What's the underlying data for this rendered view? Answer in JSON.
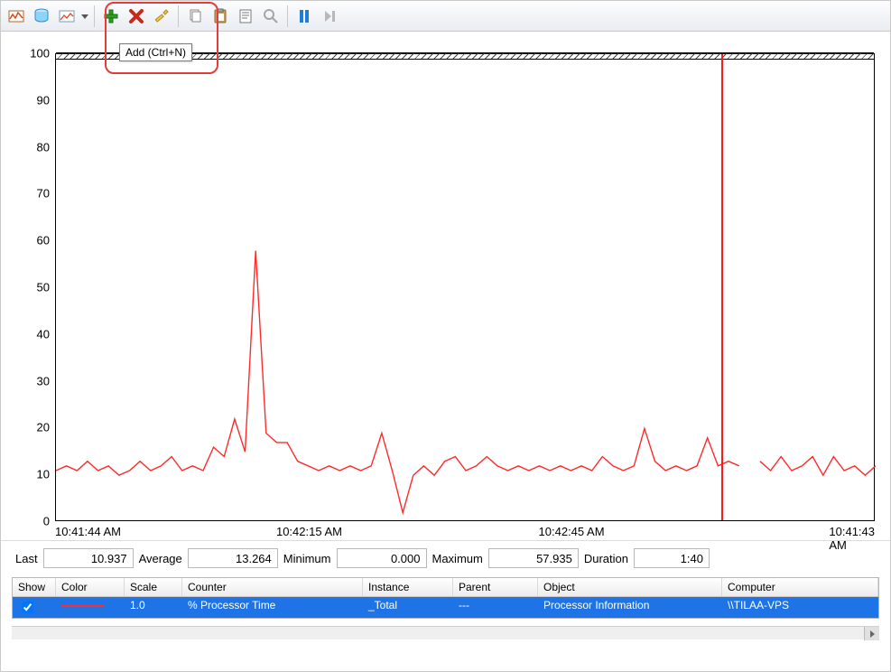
{
  "tooltip": "Add (Ctrl+N)",
  "chart_data": {
    "type": "line",
    "title": "",
    "ylabel": "",
    "xlabel": "",
    "ylim": [
      0,
      100
    ],
    "y_ticks": [
      0,
      10,
      20,
      30,
      40,
      50,
      60,
      70,
      80,
      90,
      100
    ],
    "x_ticks": [
      "10:41:44 AM",
      "10:42:15 AM",
      "10:42:45 AM",
      "10:41:43 AM"
    ],
    "cursor_x_fraction": 0.812,
    "series": [
      {
        "name": "% Processor Time",
        "color": "#ff2b2b",
        "values": [
          11,
          12,
          11,
          13,
          11,
          12,
          10,
          11,
          13,
          11,
          12,
          14,
          11,
          12,
          11,
          16,
          14,
          22,
          15,
          58,
          19,
          17,
          17,
          13,
          12,
          11,
          12,
          11,
          12,
          11,
          12,
          19,
          11,
          2,
          10,
          12,
          10,
          13,
          14,
          11,
          12,
          14,
          12,
          11,
          12,
          11,
          12,
          11,
          12,
          11,
          12,
          11,
          14,
          12,
          11,
          12,
          20,
          13,
          11,
          12,
          11,
          12,
          18,
          12,
          13,
          12,
          null,
          13,
          11,
          14,
          11,
          12,
          14,
          10,
          14,
          11,
          12,
          10,
          12
        ]
      }
    ]
  },
  "stats": {
    "last_label": "Last",
    "last_value": "10.937",
    "average_label": "Average",
    "average_value": "13.264",
    "minimum_label": "Minimum",
    "minimum_value": "0.000",
    "maximum_label": "Maximum",
    "maximum_value": "57.935",
    "duration_label": "Duration",
    "duration_value": "1:40"
  },
  "legend": {
    "headers": {
      "show": "Show",
      "color": "Color",
      "scale": "Scale",
      "counter": "Counter",
      "instance": "Instance",
      "parent": "Parent",
      "object": "Object",
      "computer": "Computer"
    },
    "row": {
      "show_checked": true,
      "scale": "1.0",
      "counter": "% Processor Time",
      "instance": "_Total",
      "parent": "---",
      "object": "Processor Information",
      "computer": "\\\\TILAA-VPS"
    }
  }
}
